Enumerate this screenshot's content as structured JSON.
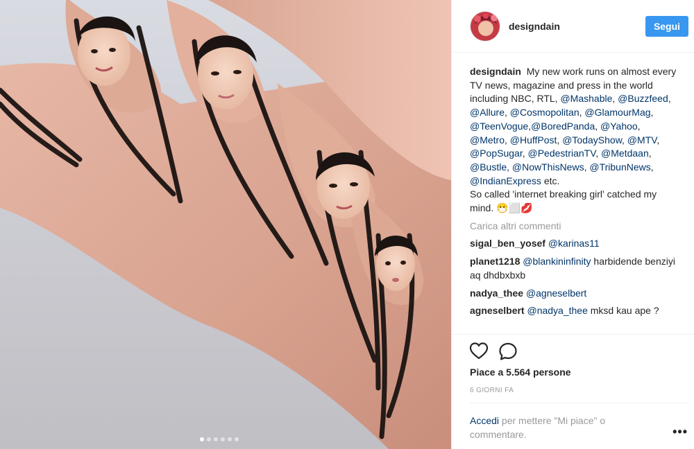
{
  "post": {
    "username": "designdain",
    "follow_label": "Segui",
    "caption": {
      "text_1": "My new work runs on almost every TV news, magazine and press in the world including NBC, RTL, ",
      "tags": [
        "@Mashable",
        "@Buzzfeed",
        "@Allure",
        "@Cosmopolitan",
        "@GlamourMag",
        "@TeenVogue",
        "@BoredPanda",
        "@Yahoo",
        "@Metro",
        "@HuffPost",
        "@TodayShow",
        "@MTV",
        "@PopSugar",
        "@PedestrianTV",
        "@Metdaan",
        "@Bustle",
        "@NowThisNews",
        "@TribunNews",
        "@IndianExpress"
      ],
      "text_2": " etc.",
      "text_3": "So called 'internet breaking girl' catched my mind. 😷⬜💋"
    },
    "load_more": "Carica altri commenti",
    "comments": [
      {
        "user": "sigal_ben_yosef",
        "mention": "@karinas11",
        "text": ""
      },
      {
        "user": "planet1218",
        "mention": "@blankininfinity",
        "text": " harbidende benziyi aq dhdbxbxb"
      },
      {
        "user": "nadya_thee",
        "mention": "@agneselbert",
        "text": ""
      },
      {
        "user": "agneselbert",
        "mention": "@nadya_thee",
        "text": " mksd kau ape ?"
      }
    ],
    "likes_text": "Piace a 5.564 persone",
    "time_ago": "6 GIORNI FA",
    "login_link": "Accedi",
    "login_rest": " per mettere \"Mi piace\" o commentare.",
    "more_label": "•••"
  },
  "icons": {
    "like": "heart-icon",
    "comment": "comment-bubble-icon",
    "more": "more-options-icon"
  },
  "carousel": {
    "count": 6,
    "active_index": 0
  },
  "colors": {
    "accent": "#3897f0",
    "link": "#003569",
    "muted": "#999999",
    "text": "#262626"
  }
}
